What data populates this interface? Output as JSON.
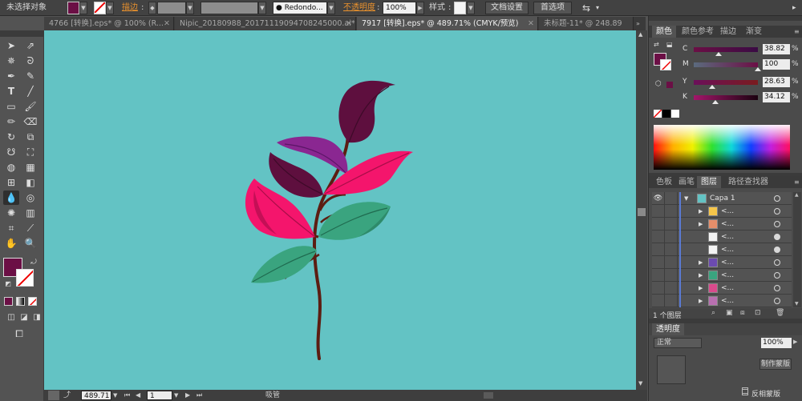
{
  "control_bar": {
    "selection_status": "未选择对象",
    "stroke_label": "描边",
    "brush_name": "Redondo...",
    "opacity_label": "不透明度",
    "opacity_value": "100%",
    "style_label": "样式",
    "doc_setup_button": "文档设置",
    "preferences_button": "首选项"
  },
  "tabs": [
    {
      "label": "4766 [转换].eps* @ 100% (R...",
      "active": false
    },
    {
      "label": "Nipic_20180988_20171119094708245000.ai*",
      "active": false
    },
    {
      "label": "7917 [转换].eps* @ 489.71% (CMYK/预览)",
      "active": true
    },
    {
      "label": "未标题-11* @ 248.89",
      "active": false
    }
  ],
  "status_bar": {
    "zoom": "489.71",
    "page": "1",
    "tool_name": "吸管"
  },
  "color_panel": {
    "tabs": [
      "颜色",
      "颜色参考",
      "描边",
      "渐变"
    ],
    "channels": [
      {
        "name": "C",
        "value": "38.82",
        "pos": 0.39
      },
      {
        "name": "M",
        "value": "100",
        "pos": 1.0
      },
      {
        "name": "Y",
        "value": "28.63",
        "pos": 0.29
      },
      {
        "name": "K",
        "value": "34.12",
        "pos": 0.34
      }
    ],
    "percent": "%"
  },
  "layers_panel": {
    "tabs": [
      "色板",
      "画笔",
      "图层",
      "路径查找器"
    ],
    "top_layer": "Capa 1",
    "sublayer_name": "<...",
    "layer_count": "1 个图层"
  },
  "transparency_panel": {
    "tab": "透明度",
    "mode": "正常",
    "opacity": "100%",
    "make_mask_button": "制作蒙版",
    "invert_mask_label": "反相蒙版"
  },
  "colors": {
    "canvas": "#63c3c4",
    "fill": "#6b0f45",
    "leaf_pink": "#f4156c",
    "leaf_dark": "#5e0f3e",
    "leaf_purple": "#8a2791",
    "leaf_green": "#3aa47f",
    "stem": "#5c1d12"
  }
}
